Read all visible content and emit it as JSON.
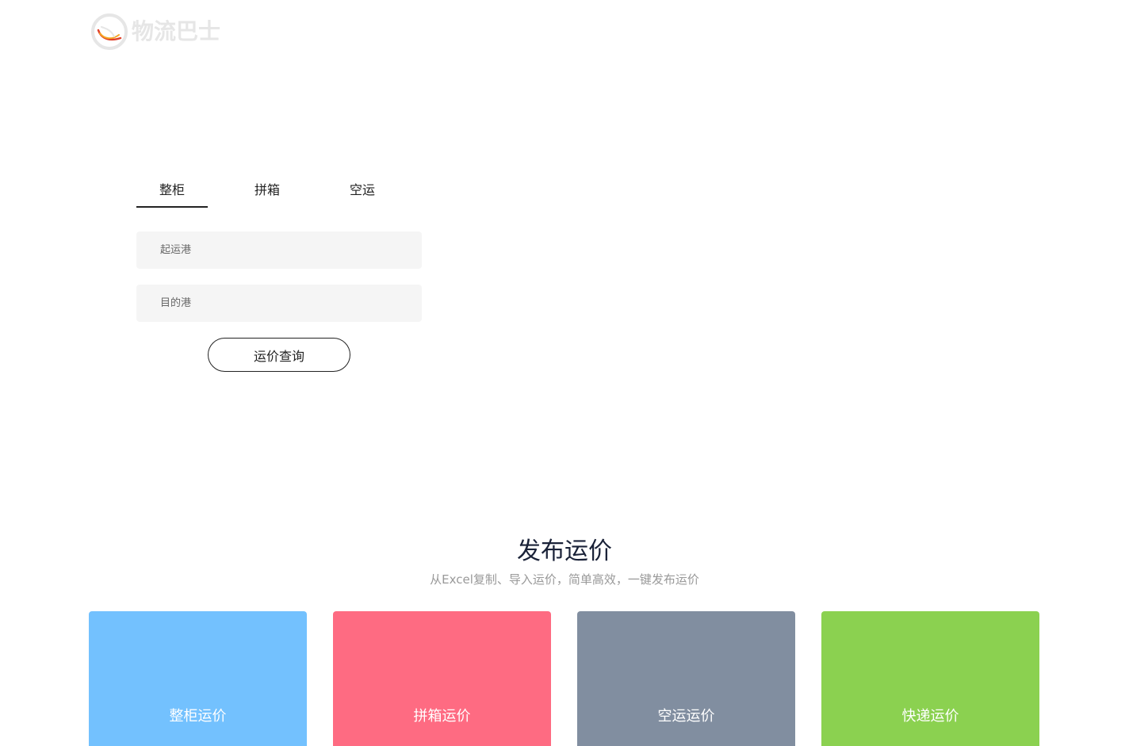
{
  "logo": {
    "text": "物流巴士",
    "icon": "logo-bus-icon"
  },
  "search": {
    "tabs": [
      {
        "label": "整柜",
        "active": true
      },
      {
        "label": "拼箱",
        "active": false
      },
      {
        "label": "空运",
        "active": false
      }
    ],
    "origin_placeholder": "起运港",
    "destination_placeholder": "目的港",
    "submit_label": "运价查询"
  },
  "publish": {
    "title": "发布运价",
    "subtitle": "从Excel复制、导入运价，简单高效，一键发布运价",
    "cards": [
      {
        "label": "整柜运价",
        "color": "#73c1fe"
      },
      {
        "label": "拼箱运价",
        "color": "#fe6b82"
      },
      {
        "label": "空运运价",
        "color": "#818ea0"
      },
      {
        "label": "快递运价",
        "color": "#8bd150"
      }
    ]
  },
  "colors": {
    "logo_gray": "#e6e6e6",
    "logo_accent_red": "#e0412b",
    "logo_accent_orange": "#f5a623",
    "field_bg": "#f5f5f5",
    "title_color": "#1a2238",
    "subtitle_color": "#999999"
  }
}
